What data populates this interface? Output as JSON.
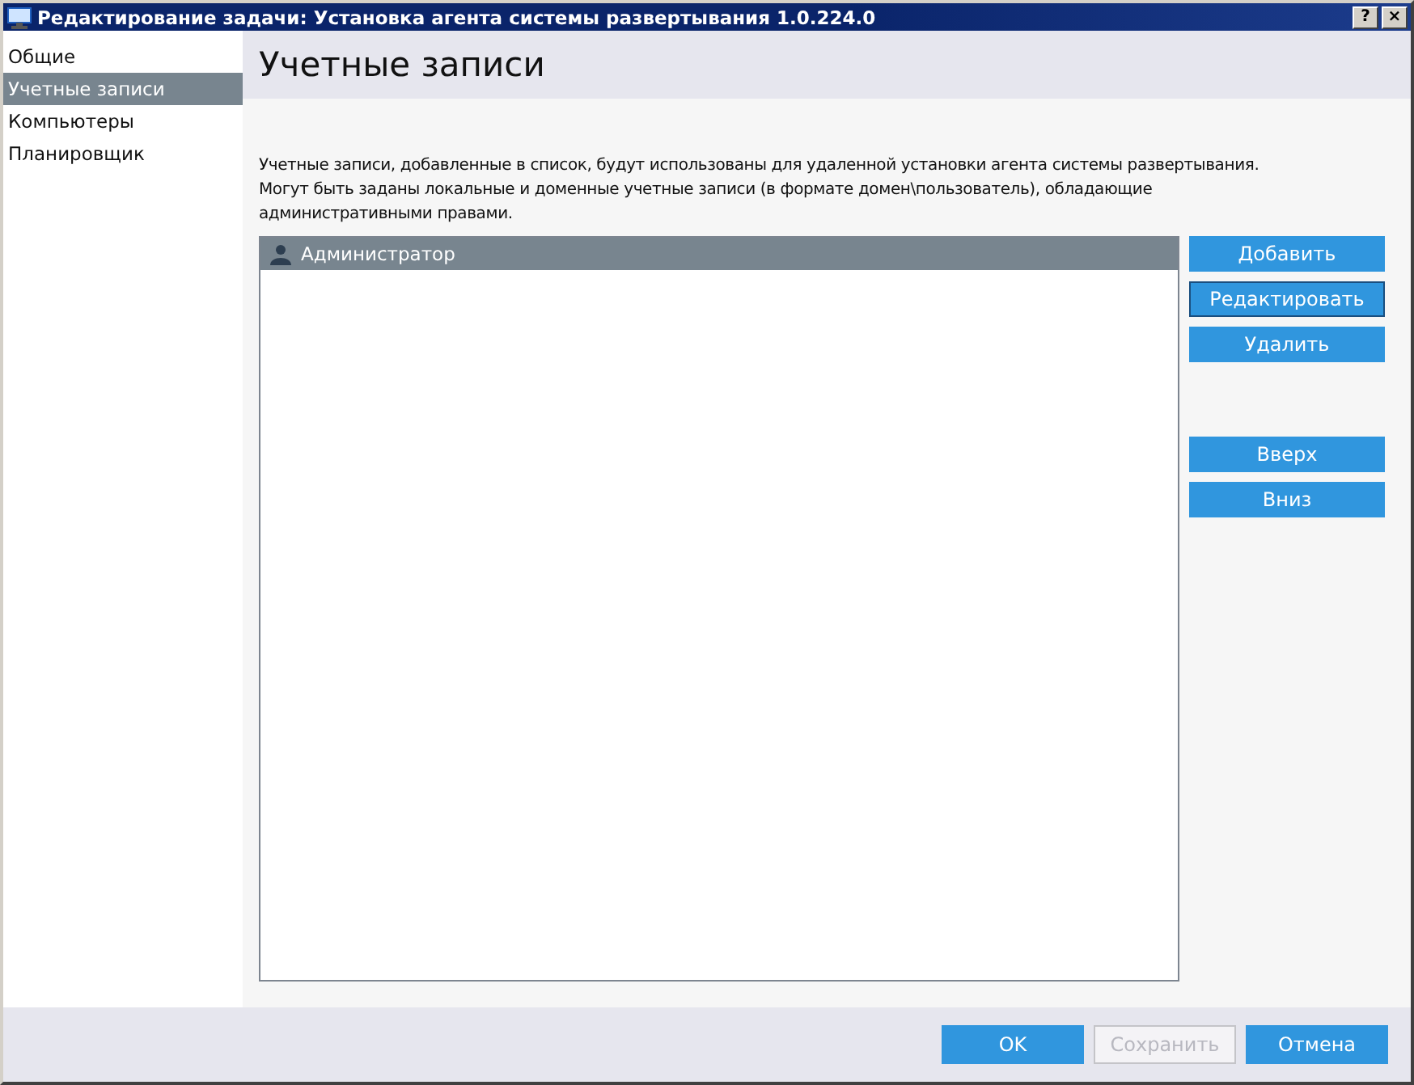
{
  "window": {
    "title": "Редактирование задачи: Установка агента системы развертывания 1.0.224.0",
    "controls": [
      "?",
      "×"
    ]
  },
  "sidebar": {
    "items": [
      {
        "label": "Общие",
        "selected": false
      },
      {
        "label": "Учетные записи",
        "selected": true
      },
      {
        "label": "Компьютеры",
        "selected": false
      },
      {
        "label": "Планировщик",
        "selected": false
      }
    ]
  },
  "page": {
    "title": "Учетные записи",
    "description": "Учетные записи, добавленные в список, будут использованы для удаленной установки агента системы развертывания. Могут быть заданы локальные и доменные учетные записи (в формате домен\\пользователь), обладающие административными правами."
  },
  "accounts": [
    {
      "name": "Администратор",
      "selected": true
    }
  ],
  "edit_buttons": [
    {
      "label": "Добавить",
      "focused": false
    },
    {
      "label": "Редактировать",
      "focused": true
    },
    {
      "label": "Удалить",
      "focused": false
    }
  ],
  "move_buttons": [
    {
      "label": "Вверх",
      "focused": false
    },
    {
      "label": "Вниз",
      "focused": false
    }
  ],
  "footer_buttons": [
    {
      "label": "OK",
      "disabled": false
    },
    {
      "label": "Сохранить",
      "disabled": true
    },
    {
      "label": "Отмена",
      "disabled": false
    }
  ]
}
